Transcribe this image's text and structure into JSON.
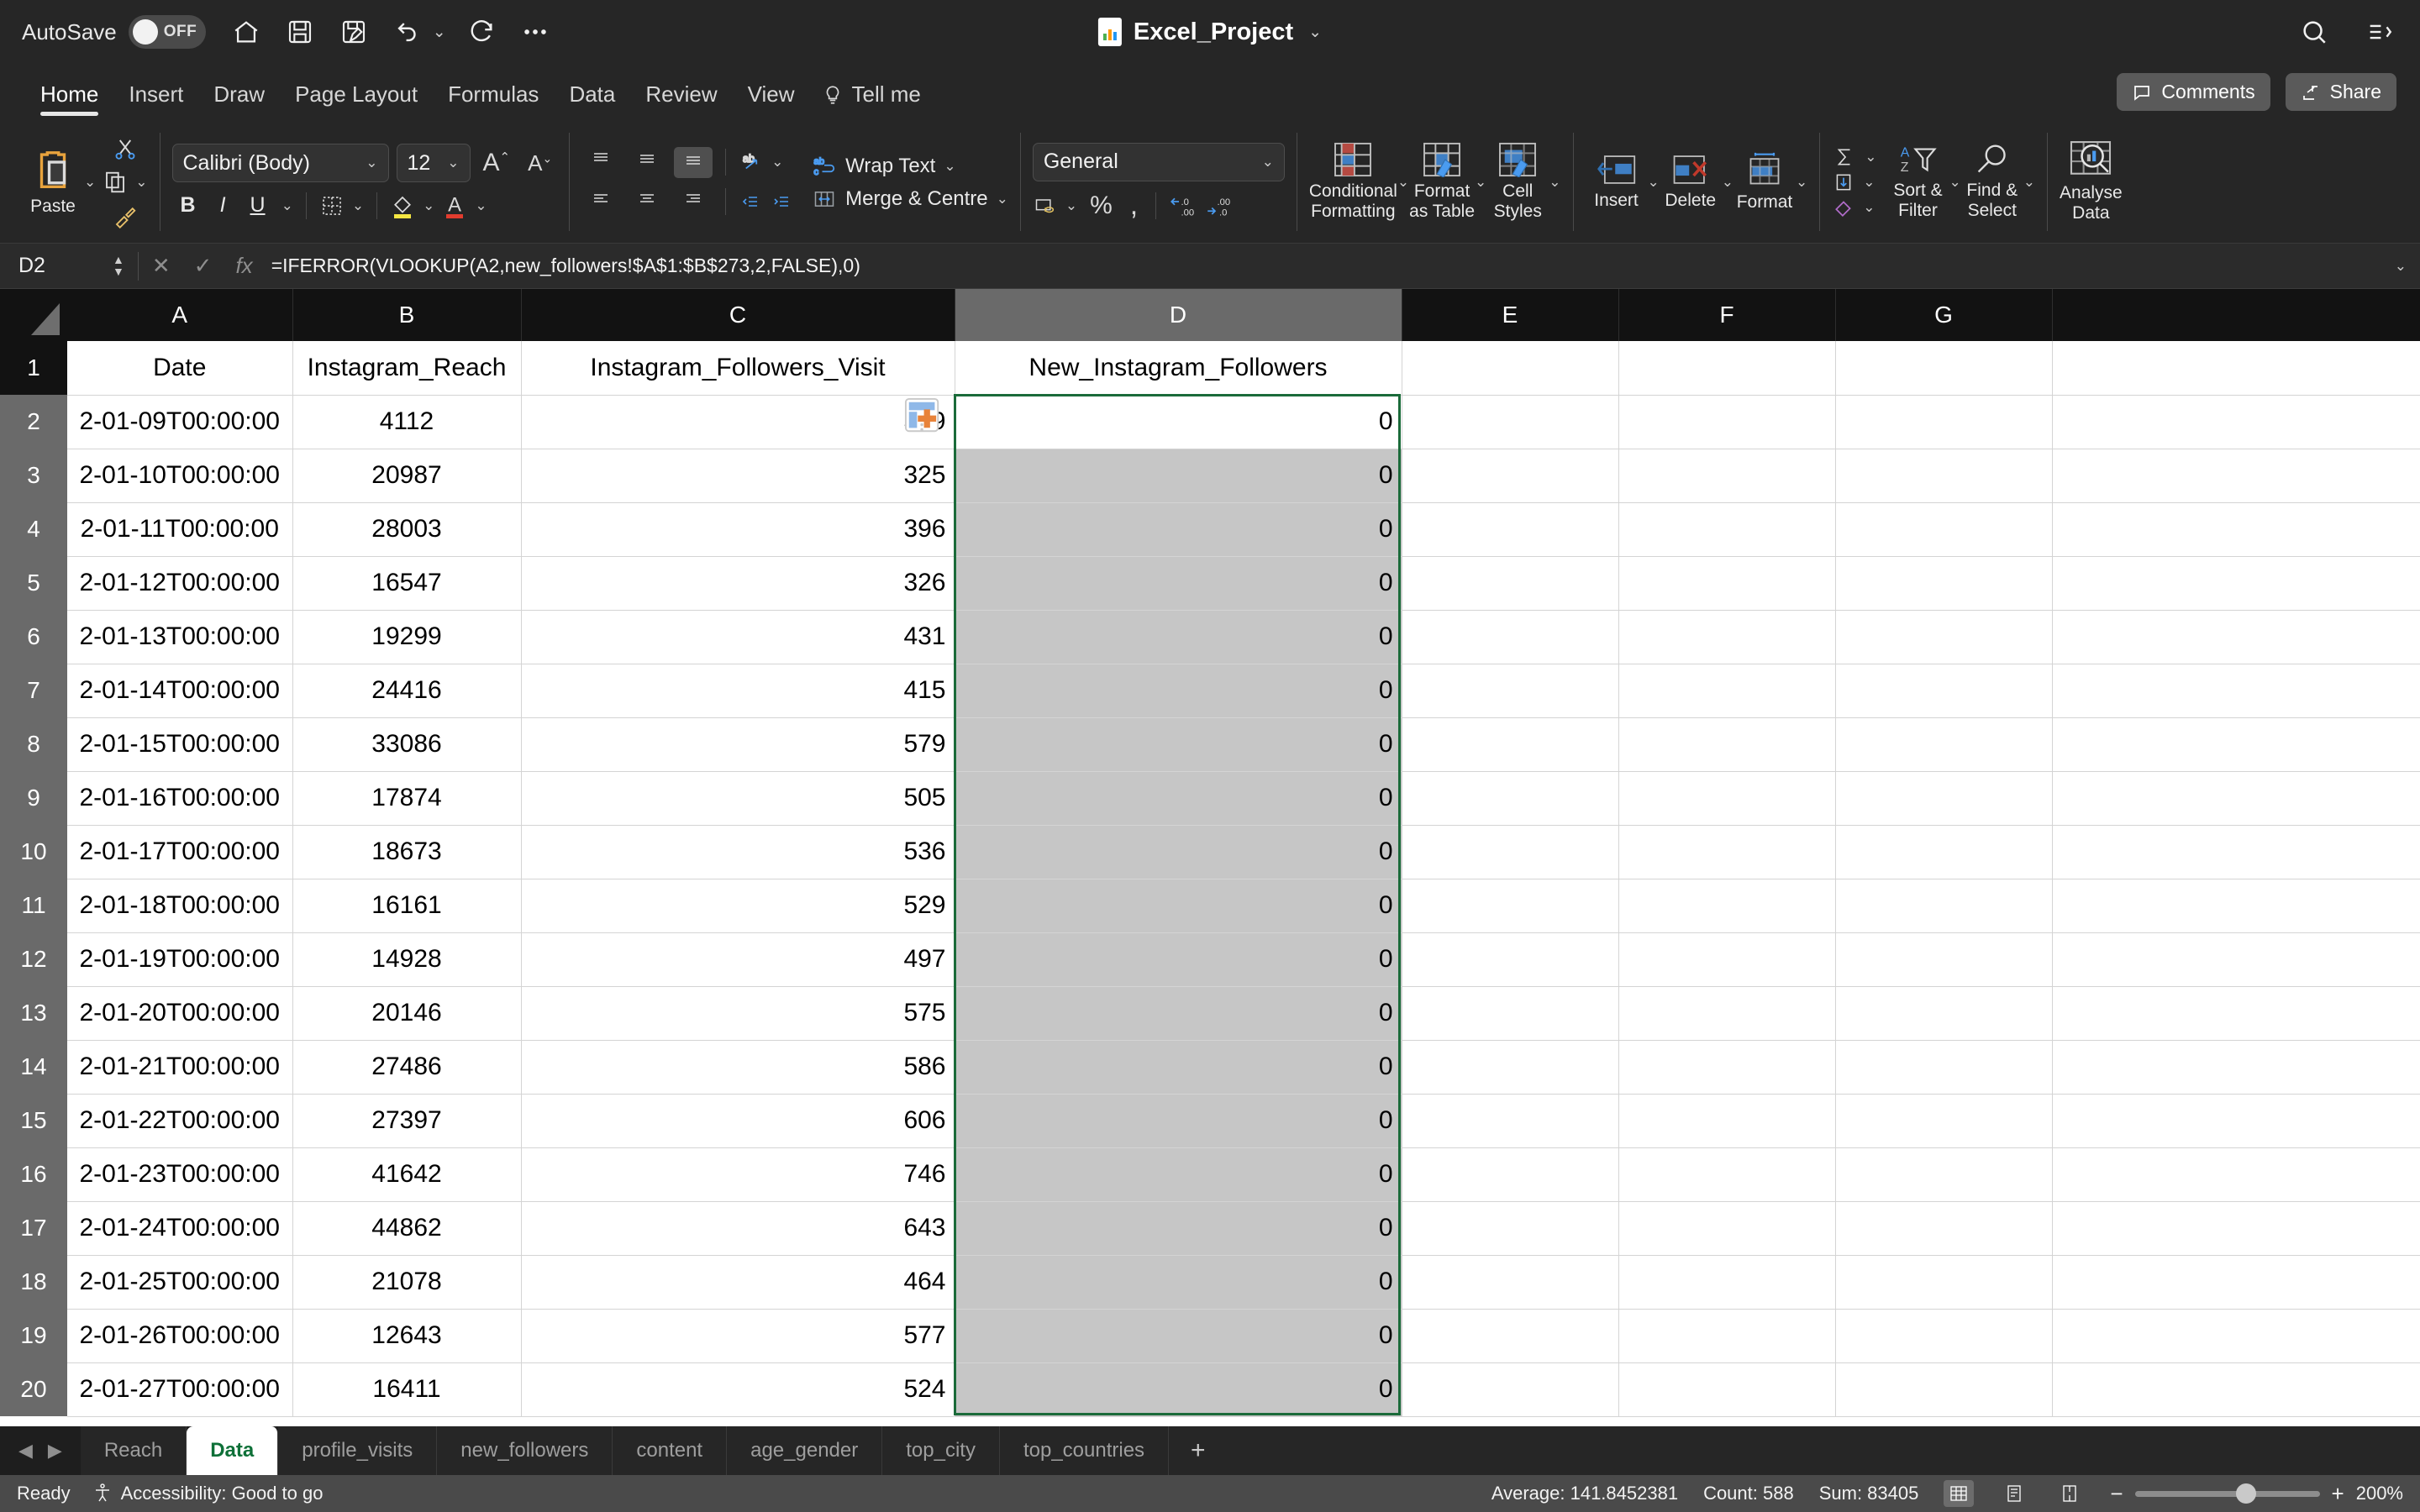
{
  "titlebar": {
    "autosave_label": "AutoSave",
    "autosave_state": "OFF",
    "document_title": "Excel_Project",
    "quick_access": [
      "home-icon",
      "save-icon",
      "save-as-icon",
      "undo-icon",
      "redo-icon",
      "more-icon"
    ],
    "right_icons": [
      "search-icon",
      "ribbon-display-icon"
    ]
  },
  "tabs": [
    {
      "label": "Home",
      "active": true
    },
    {
      "label": "Insert",
      "active": false
    },
    {
      "label": "Draw",
      "active": false
    },
    {
      "label": "Page Layout",
      "active": false
    },
    {
      "label": "Formulas",
      "active": false
    },
    {
      "label": "Data",
      "active": false
    },
    {
      "label": "Review",
      "active": false
    },
    {
      "label": "View",
      "active": false
    }
  ],
  "tellme": "Tell me",
  "comments_label": "Comments",
  "share_label": "Share",
  "ribbon": {
    "paste_label": "Paste",
    "font_name": "Calibri (Body)",
    "font_size": "12",
    "bold": "B",
    "italic": "I",
    "underline": "U",
    "wrap_text": "Wrap Text",
    "merge_centre": "Merge & Centre",
    "number_format": "General",
    "percent": "%",
    "comma": ",",
    "conditional_formatting": "Conditional\nFormatting",
    "conditional_formatting_l1": "Conditional",
    "conditional_formatting_l2": "Formatting",
    "format_as_table_l1": "Format",
    "format_as_table_l2": "as Table",
    "cell_styles_l1": "Cell",
    "cell_styles_l2": "Styles",
    "insert": "Insert",
    "delete": "Delete",
    "format": "Format",
    "sort_filter_l1": "Sort &",
    "sort_filter_l2": "Filter",
    "find_select_l1": "Find &",
    "find_select_l2": "Select",
    "analyse_data_l1": "Analyse",
    "analyse_data_l2": "Data"
  },
  "formula_bar": {
    "name_box": "D2",
    "formula": "=IFERROR(VLOOKUP(A2,new_followers!$A$1:$B$273,2,FALSE),0)",
    "cancel_icon": "cancel-icon",
    "confirm_icon": "confirm-icon",
    "function_icon": "fx-icon"
  },
  "grid": {
    "column_letters": [
      "A",
      "B",
      "C",
      "D",
      "E",
      "F",
      "G"
    ],
    "selected_column": "D",
    "headers": [
      "Date",
      "Instagram_Reach",
      "Instagram_Followers_Visit",
      "New_Instagram_Followers"
    ],
    "rows": [
      {
        "n": "1",
        "a": "Date",
        "b": "Instagram_Reach",
        "c": "Instagram_Followers_Visit",
        "d": "New_Instagram_Followers"
      },
      {
        "n": "2",
        "a": "2-01-09T00:00:00",
        "b": "4112",
        "c": "359",
        "d": "0"
      },
      {
        "n": "3",
        "a": "2-01-10T00:00:00",
        "b": "20987",
        "c": "325",
        "d": "0"
      },
      {
        "n": "4",
        "a": "2-01-11T00:00:00",
        "b": "28003",
        "c": "396",
        "d": "0"
      },
      {
        "n": "5",
        "a": "2-01-12T00:00:00",
        "b": "16547",
        "c": "326",
        "d": "0"
      },
      {
        "n": "6",
        "a": "2-01-13T00:00:00",
        "b": "19299",
        "c": "431",
        "d": "0"
      },
      {
        "n": "7",
        "a": "2-01-14T00:00:00",
        "b": "24416",
        "c": "415",
        "d": "0"
      },
      {
        "n": "8",
        "a": "2-01-15T00:00:00",
        "b": "33086",
        "c": "579",
        "d": "0"
      },
      {
        "n": "9",
        "a": "2-01-16T00:00:00",
        "b": "17874",
        "c": "505",
        "d": "0"
      },
      {
        "n": "10",
        "a": "2-01-17T00:00:00",
        "b": "18673",
        "c": "536",
        "d": "0"
      },
      {
        "n": "11",
        "a": "2-01-18T00:00:00",
        "b": "16161",
        "c": "529",
        "d": "0"
      },
      {
        "n": "12",
        "a": "2-01-19T00:00:00",
        "b": "14928",
        "c": "497",
        "d": "0"
      },
      {
        "n": "13",
        "a": "2-01-20T00:00:00",
        "b": "20146",
        "c": "575",
        "d": "0"
      },
      {
        "n": "14",
        "a": "2-01-21T00:00:00",
        "b": "27486",
        "c": "586",
        "d": "0"
      },
      {
        "n": "15",
        "a": "2-01-22T00:00:00",
        "b": "27397",
        "c": "606",
        "d": "0"
      },
      {
        "n": "16",
        "a": "2-01-23T00:00:00",
        "b": "41642",
        "c": "746",
        "d": "0"
      },
      {
        "n": "17",
        "a": "2-01-24T00:00:00",
        "b": "44862",
        "c": "643",
        "d": "0"
      },
      {
        "n": "18",
        "a": "2-01-25T00:00:00",
        "b": "21078",
        "c": "464",
        "d": "0"
      },
      {
        "n": "19",
        "a": "2-01-26T00:00:00",
        "b": "12643",
        "c": "577",
        "d": "0"
      },
      {
        "n": "20",
        "a": "2-01-27T00:00:00",
        "b": "16411",
        "c": "524",
        "d": "0"
      }
    ]
  },
  "sheet_tabs": [
    {
      "label": "Reach",
      "active": false
    },
    {
      "label": "Data",
      "active": true
    },
    {
      "label": "profile_visits",
      "active": false
    },
    {
      "label": "new_followers",
      "active": false
    },
    {
      "label": "content",
      "active": false
    },
    {
      "label": "age_gender",
      "active": false
    },
    {
      "label": "top_city",
      "active": false
    },
    {
      "label": "top_countries",
      "active": false
    }
  ],
  "add_sheet": "+",
  "status_bar": {
    "ready": "Ready",
    "accessibility": "Accessibility: Good to go",
    "average": "Average: 141.8452381",
    "count": "Count: 588",
    "sum": "Sum: 83405",
    "zoom": "200%",
    "zoom_out": "−",
    "zoom_in": "+"
  },
  "colors": {
    "accent_green": "#1b6b3a",
    "tab_active_text": "#0e7038",
    "selection_fill": "#c6c6c6",
    "chrome_dark": "#262626",
    "status_bar": "#4a4a4a"
  }
}
